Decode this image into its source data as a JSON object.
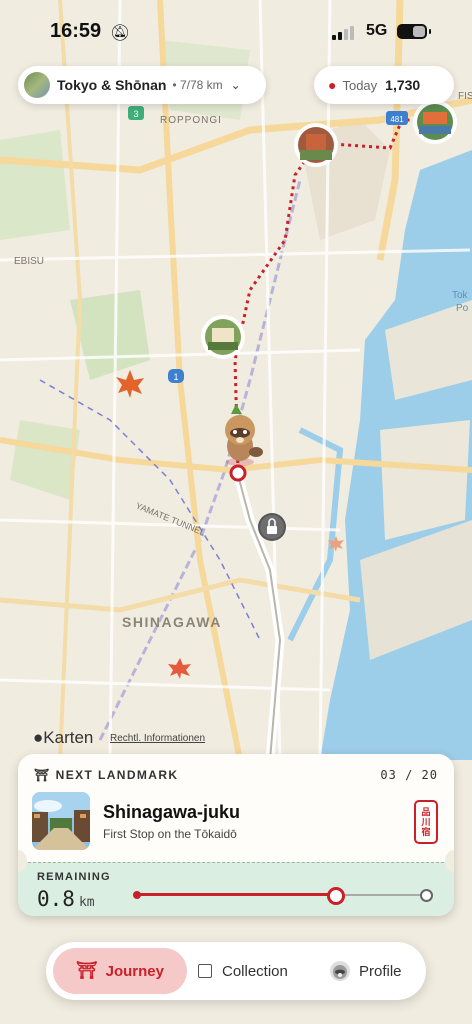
{
  "status_bar": {
    "time": "16:59",
    "network": "5G"
  },
  "route": {
    "name": "Tokyo & Shōnan",
    "distance": "• 7/78 km"
  },
  "steps": {
    "label": "Today",
    "value": "1,730"
  },
  "map": {
    "labels": {
      "roppongi": "ROPPONGI",
      "ebisu": "EBISU",
      "shinagawa": "SHINAGAWA",
      "yamate": "YAMATE TUNNEL",
      "tok": "Tok",
      "po": "Po",
      "fis": "FIS",
      "road3": "3",
      "road481": "481",
      "road1": "1"
    },
    "attribution": "Karten",
    "legal": "Rechtl. Informationen"
  },
  "next_landmark": {
    "header": "NEXT LANDMARK",
    "count": "03 / 20",
    "name": "Shinagawa-juku",
    "subtitle": "First Stop on the Tōkaidō",
    "stamp_chars": [
      "品",
      "川",
      "宿"
    ],
    "remaining_label": "REMAINING",
    "remaining_value": "0.8",
    "remaining_unit": "km",
    "progress": 0.68
  },
  "tabs": {
    "journey": "Journey",
    "collection": "Collection",
    "profile": "Profile"
  },
  "colors": {
    "accent": "#c9202a",
    "water": "#98cbe8",
    "card_tint": "#dbeee2"
  }
}
